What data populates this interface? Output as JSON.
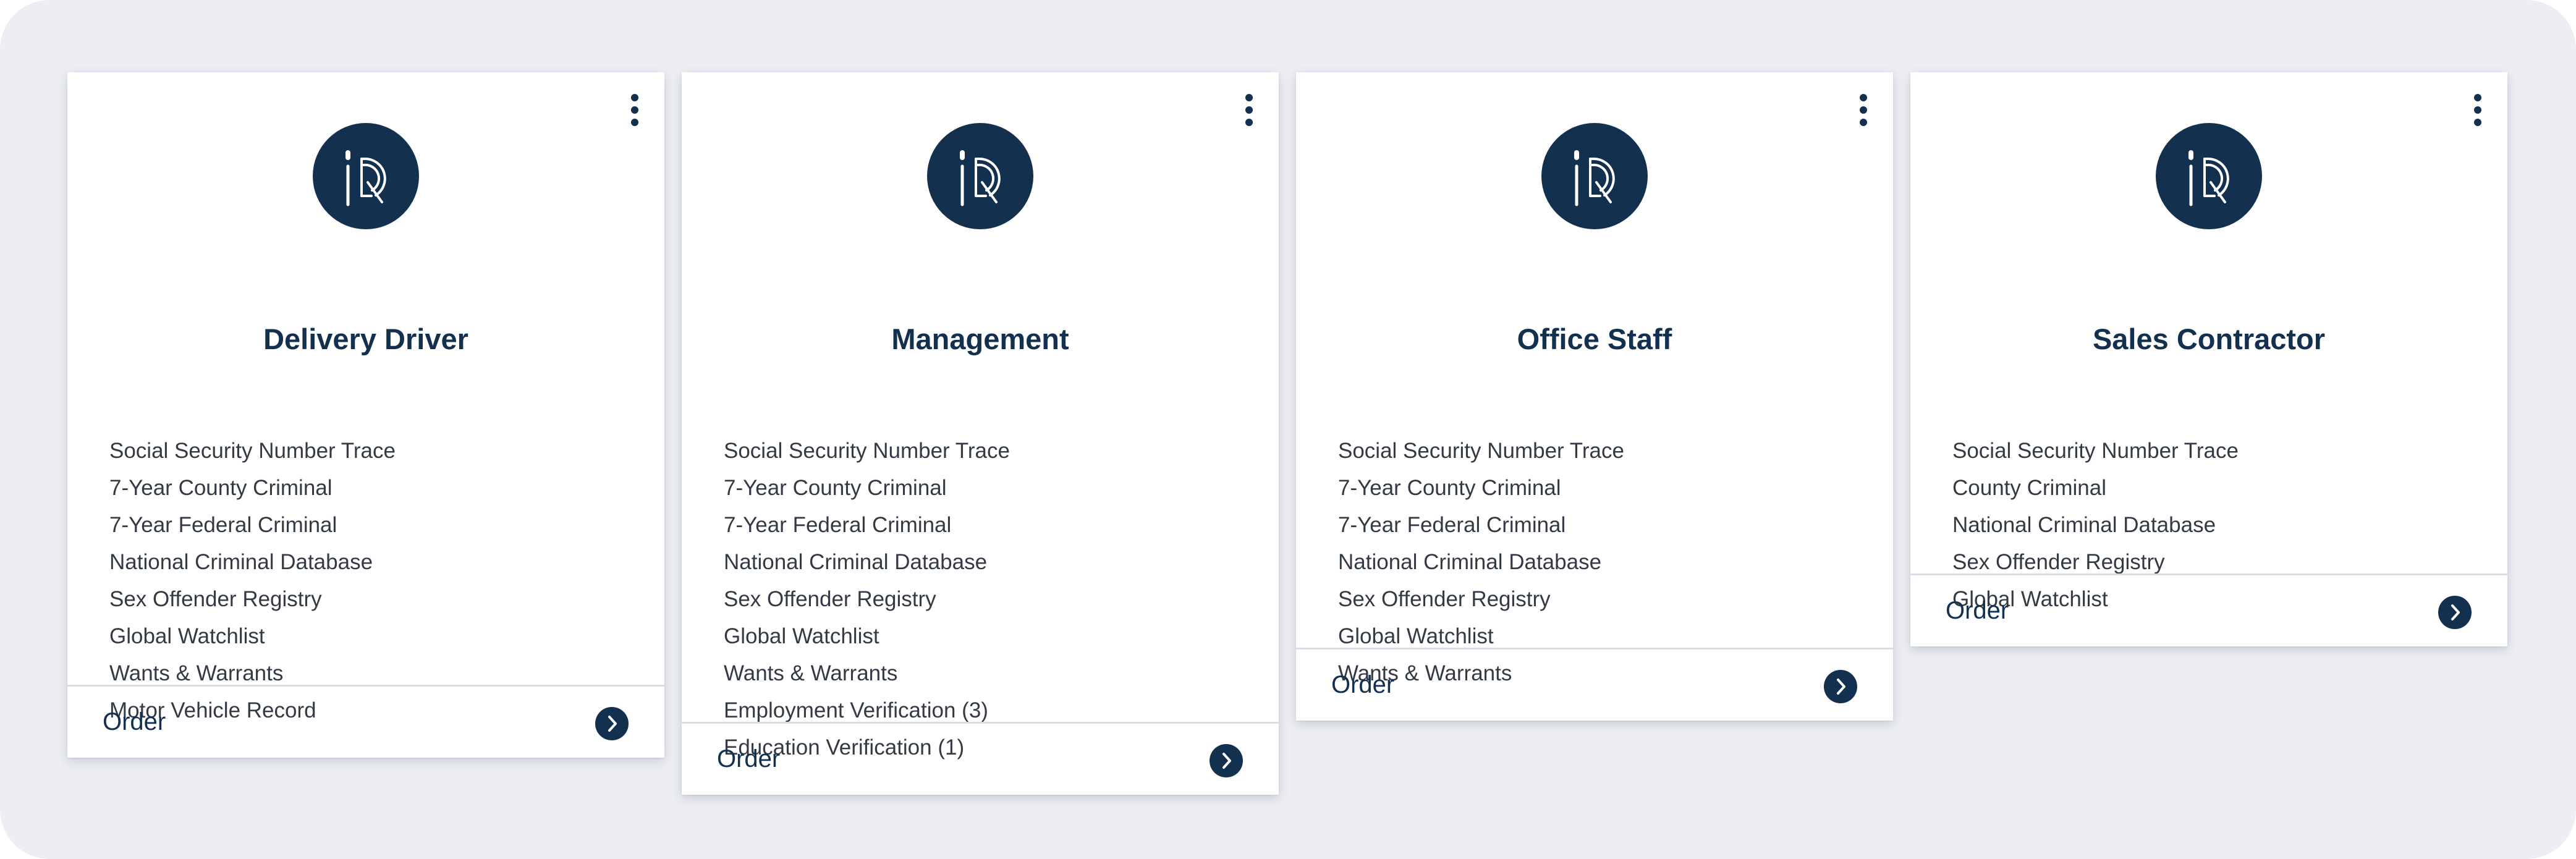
{
  "colors": {
    "background": "#eceef3",
    "card": "#ffffff",
    "navy": "#14304f",
    "text": "#333a43",
    "divider": "#d9dde3"
  },
  "icons": {
    "menu": "more-vertical-icon",
    "logo": "id-logo-icon",
    "order": "chevron-right-circle-icon"
  },
  "cards": [
    {
      "title": "Delivery Driver",
      "items": [
        "Social Security Number Trace",
        "7-Year County Criminal",
        "7-Year Federal Criminal",
        "National Criminal Database",
        "Sex Offender Registry",
        "Global Watchlist",
        "Wants & Warrants",
        "Motor Vehicle Record"
      ],
      "order_label": "Order"
    },
    {
      "title": "Management",
      "items": [
        "Social Security Number Trace",
        "7-Year County Criminal",
        "7-Year Federal Criminal",
        "National Criminal Database",
        "Sex Offender Registry",
        "Global Watchlist",
        "Wants & Warrants",
        "Employment Verification (3)",
        "Education Verification (1)"
      ],
      "order_label": "Order"
    },
    {
      "title": "Office Staff",
      "items": [
        "Social Security Number Trace",
        "7-Year County Criminal",
        "7-Year Federal Criminal",
        "National Criminal Database",
        "Sex Offender Registry",
        "Global Watchlist",
        "Wants & Warrants"
      ],
      "order_label": "Order"
    },
    {
      "title": "Sales Contractor",
      "items": [
        "Social Security Number Trace",
        "County Criminal",
        "National Criminal Database",
        "Sex Offender Registry",
        "Global Watchlist"
      ],
      "order_label": "Order"
    }
  ]
}
